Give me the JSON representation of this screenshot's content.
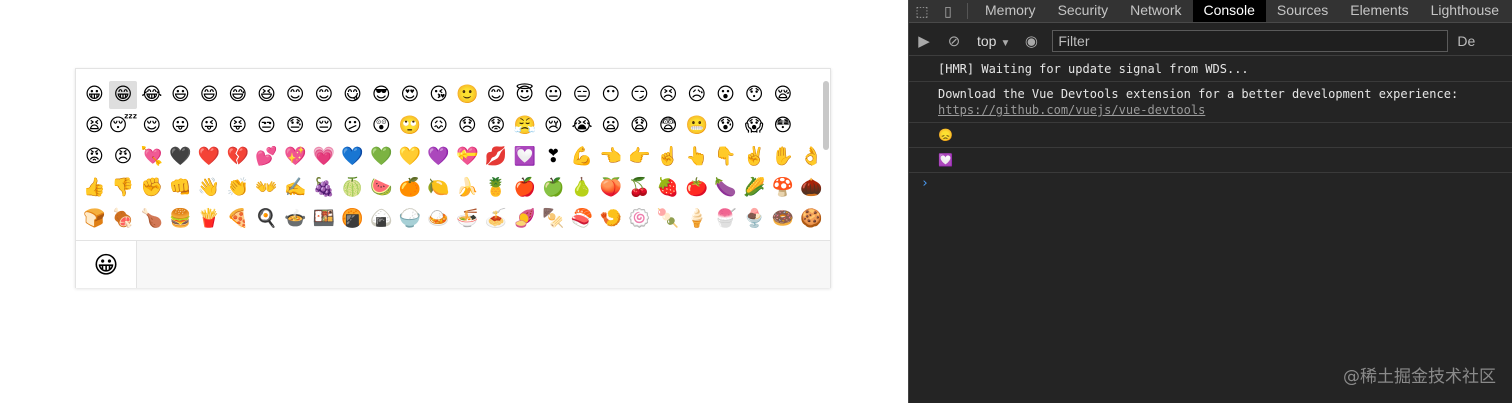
{
  "picker": {
    "rows": [
      [
        "😀",
        "😁",
        "😂",
        "😃",
        "😄",
        "😅",
        "😆",
        "😊",
        "😊",
        "😋",
        "😎",
        "😍",
        "😘",
        "🙂",
        "😊",
        "😇",
        "😐",
        "😑",
        "😶",
        "😏",
        "😣",
        "😥",
        "😮",
        "😯",
        "😪"
      ],
      [
        "😫",
        "😴",
        "😌",
        "😛",
        "😜",
        "😝",
        "😒",
        "😓",
        "😔",
        "😕",
        "😲",
        "🙄",
        "😖",
        "😞",
        "😟",
        "😤",
        "😢",
        "😭",
        "😦",
        "😧",
        "😨",
        "😬",
        "😰",
        "😱",
        "😳"
      ],
      [
        "😡",
        "😠",
        "💘",
        "🖤",
        "❤️",
        "💔",
        "💕",
        "💖",
        "💗",
        "💙",
        "💚",
        "💛",
        "💜",
        "💝",
        "💋",
        "💟",
        "❣",
        "💪",
        "👈",
        "👉",
        "☝️",
        "👆",
        "👇",
        "✌️",
        "✋",
        "👌"
      ],
      [
        "👍",
        "👎",
        "✊",
        "👊",
        "👋",
        "👏",
        "👐",
        "✍️",
        "🍇",
        "🍈",
        "🍉",
        "🍊",
        "🍋",
        "🍌",
        "🍍",
        "🍎",
        "🍏",
        "🍐",
        "🍑",
        "🍒",
        "🍓",
        "🍅",
        "🍆",
        "🌽",
        "🍄",
        "🌰"
      ],
      [
        "🍞",
        "🍖",
        "🍗",
        "🍔",
        "🍟",
        "🍕",
        "🍳",
        "🍲",
        "🍱",
        "🍘",
        "🍙",
        "🍚",
        "🍛",
        "🍜",
        "🍝",
        "🍠",
        "🍢",
        "🍣",
        "🍤",
        "🍥",
        "🍡",
        "🍦",
        "🍧",
        "🍨",
        "🍩",
        "🍪"
      ]
    ],
    "hover_index": [
      0,
      1
    ],
    "footer_tab_icon": "😀"
  },
  "devtools": {
    "tabs": [
      "Memory",
      "Security",
      "Network",
      "Console",
      "Sources",
      "Elements",
      "Lighthouse"
    ],
    "active_tab": "Console",
    "context": "top",
    "filter_placeholder": "Filter",
    "trailing": "De",
    "messages": [
      {
        "text": "[HMR] Waiting for update signal from WDS..."
      },
      {
        "text": "Download the Vue Devtools extension for a better development experience:",
        "link": "https://github.com/vuejs/vue-devtools"
      },
      {
        "text": "😞"
      },
      {
        "text": "💟"
      }
    ],
    "prompt": "›"
  },
  "watermark": "@稀土掘金技术社区",
  "colors": {
    "devtools_bg": "#242424",
    "tab_bar_bg": "#333333",
    "active_tab_bg": "#000000",
    "link": "#9a9a9a",
    "prompt": "#4a9cf5"
  }
}
